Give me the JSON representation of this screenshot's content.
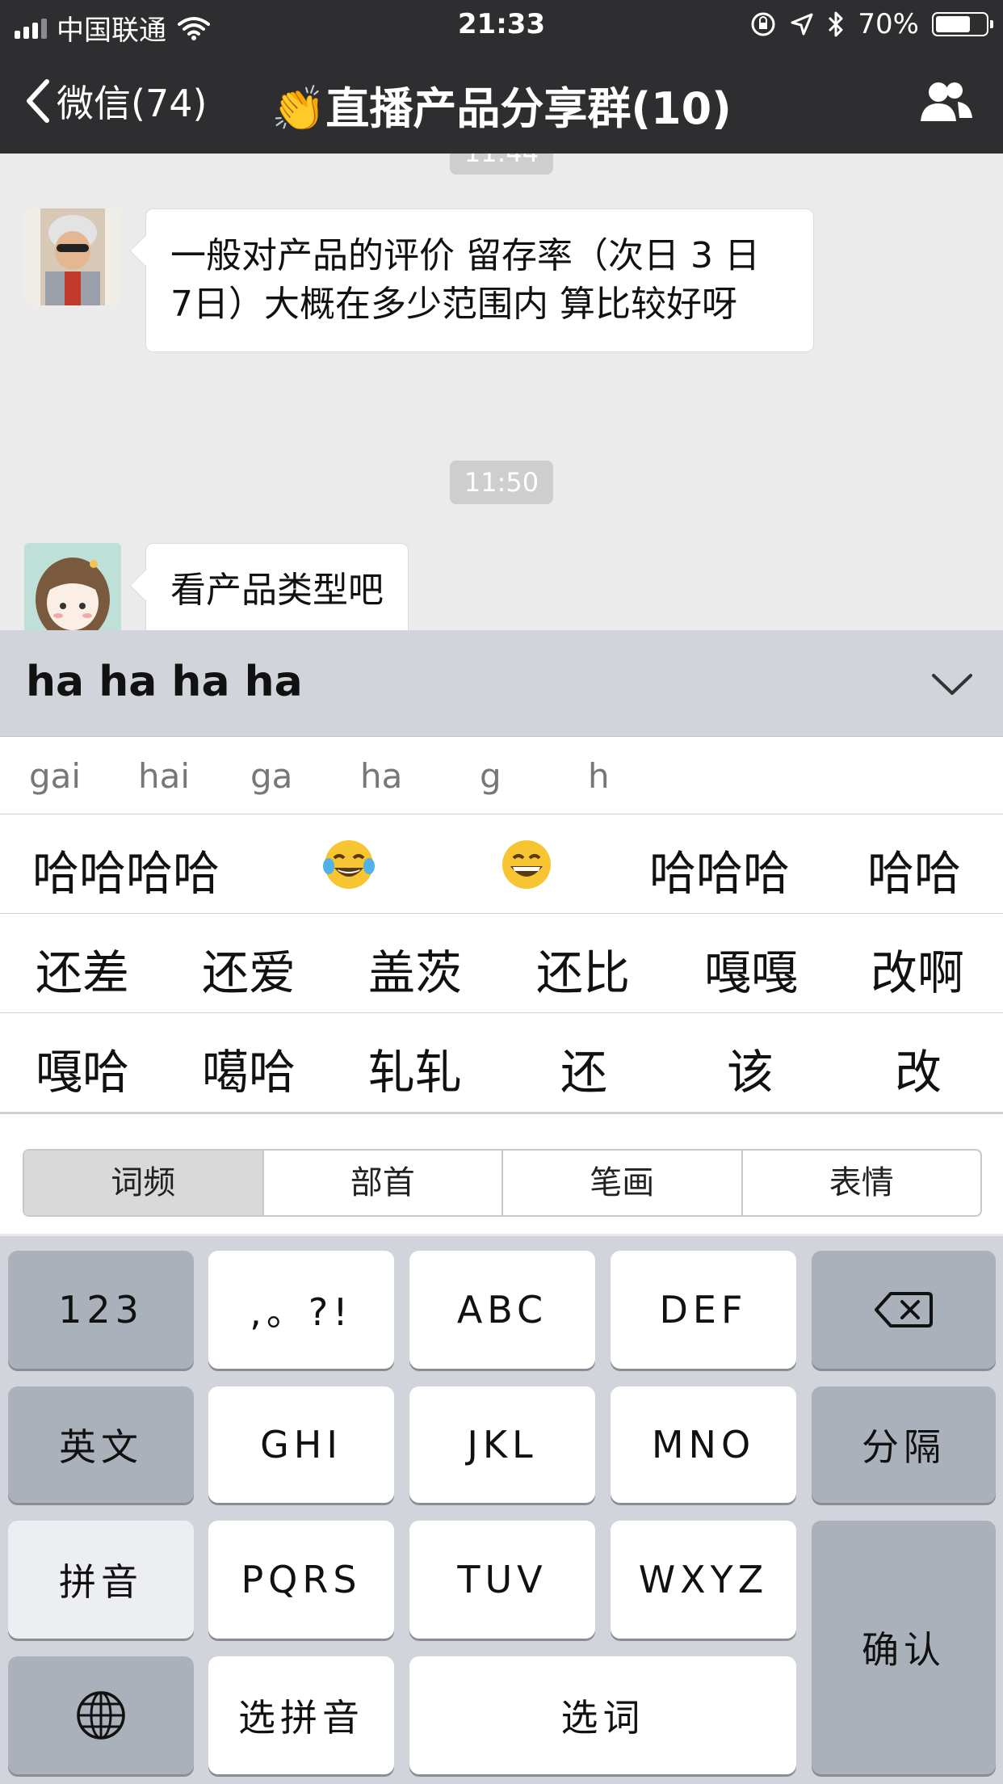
{
  "status_bar": {
    "carrier": "中国联通",
    "time": "21:33",
    "battery": "70%",
    "battery_level": 0.7
  },
  "nav": {
    "back_label": "微信(74)",
    "title": "👏直播产品分享群(10)"
  },
  "chat": {
    "timestamp_top": "11:44",
    "messages": [
      {
        "text": "一般对产品的评价  留存率（次日 3 日 7日）大概在多少范围内  算比较好呀"
      },
      {
        "text": "看产品类型吧"
      }
    ],
    "timestamp_mid": "11:50"
  },
  "ime": {
    "composing_text": "ha ha ha ha",
    "pinyin_options": [
      "gai",
      "hai",
      "ga",
      "ha",
      "g",
      "h"
    ],
    "candidates_row1": [
      "哈哈哈哈",
      "😂",
      "😄",
      "哈哈哈",
      "哈哈"
    ],
    "candidates_row2": [
      "还差",
      "还爱",
      "盖茨",
      "还比",
      "嘎嘎",
      "改啊"
    ],
    "candidates_row3": [
      "嘎哈",
      "噶哈",
      "轧轧",
      "还",
      "该",
      "改"
    ],
    "sort_tabs": [
      "词频",
      "部首",
      "笔画",
      "表情"
    ]
  },
  "keyboard": {
    "k123": "123",
    "punct": ",。?!",
    "abc": "ABC",
    "def": "DEF",
    "english": "英文",
    "ghi": "GHI",
    "jkl": "JKL",
    "mno": "MNO",
    "separator": "分隔",
    "pinyin": "拼音",
    "pqrs": "PQRS",
    "tuv": "TUV",
    "wxyz": "WXYZ",
    "confirm": "确认",
    "select_pinyin": "选拼音",
    "select_word": "选词"
  }
}
